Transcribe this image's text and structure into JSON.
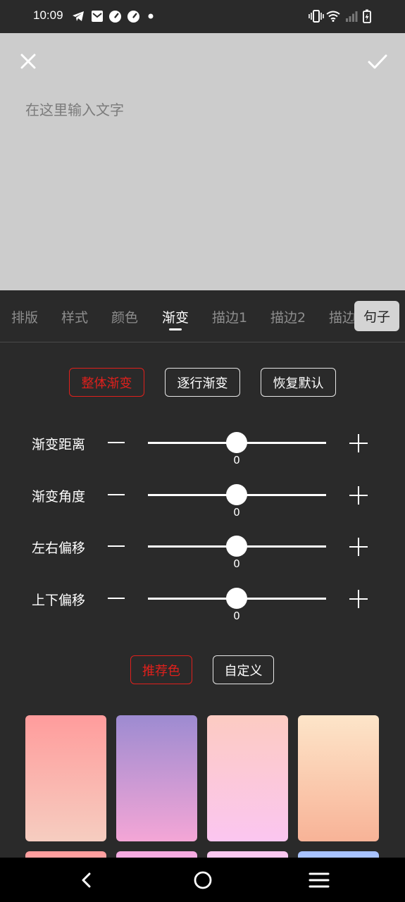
{
  "status_bar": {
    "time": "10:09",
    "icons_left": [
      "telegram-icon",
      "mail-icon",
      "speedometer-icon",
      "speedometer-icon",
      "dot-icon"
    ],
    "icons_right": [
      "vibrate-icon",
      "wifi-icon",
      "signal-icon",
      "battery-charging-icon"
    ]
  },
  "editor": {
    "placeholder": "在这里输入文字",
    "value": ""
  },
  "tabs": {
    "items": [
      {
        "label": "排版"
      },
      {
        "label": "样式"
      },
      {
        "label": "颜色"
      },
      {
        "label": "渐变"
      },
      {
        "label": "描边1"
      },
      {
        "label": "描边2"
      },
      {
        "label": "描边"
      }
    ],
    "active": "渐变",
    "sentence": "句子"
  },
  "modes": {
    "whole": "整体渐变",
    "per_line": "逐行渐变",
    "reset": "恢复默认",
    "selected": "整体渐变"
  },
  "sliders": [
    {
      "label": "渐变距离",
      "value": 0,
      "position": 0.5
    },
    {
      "label": "渐变角度",
      "value": 0,
      "position": 0.5
    },
    {
      "label": "左右偏移",
      "value": 0,
      "position": 0.5
    },
    {
      "label": "上下偏移",
      "value": 0,
      "position": 0.5
    }
  ],
  "palette_tabs": {
    "recommended": "推荐色",
    "custom": "自定义",
    "selected": "推荐色"
  },
  "swatches": [
    {
      "from": "#ff9c9c",
      "to": "#f6cdc0"
    },
    {
      "from": "#9d8bd1",
      "to": "#f4a6d6"
    },
    {
      "from": "#fccbc2",
      "to": "#fbc6f0"
    },
    {
      "from": "#fde5c9",
      "to": "#f8b397"
    },
    {
      "from": "#ff9c9c",
      "to": "#ffb0b0"
    },
    {
      "from": "#f6a8e0",
      "to": "#f6b8e8"
    },
    {
      "from": "#fbc6f0",
      "to": "#fcd0f2"
    },
    {
      "from": "#a5c0ff",
      "to": "#b8cfff"
    }
  ],
  "colors": {
    "accent": "#e0201c",
    "background": "#2a2a2a",
    "editor_bg": "#cccccc"
  },
  "nav": [
    "back-icon",
    "home-icon",
    "menu-icon"
  ]
}
